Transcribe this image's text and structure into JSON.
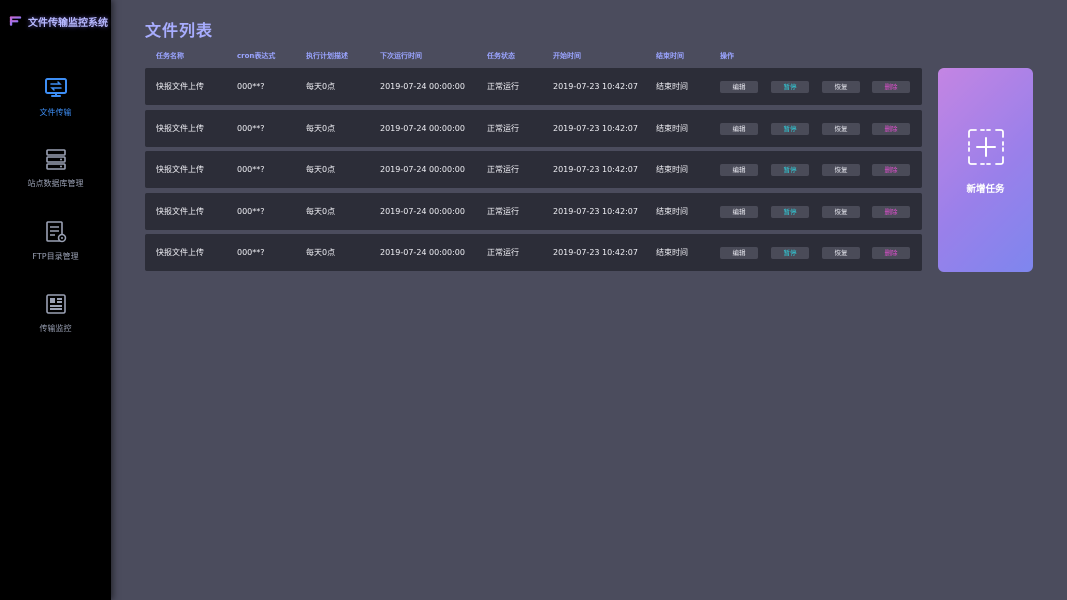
{
  "app": {
    "title": "文件传输监控系统"
  },
  "sidebar": {
    "items": [
      {
        "label": "文件传输",
        "icon": "monitor-transfer-icon",
        "active": true
      },
      {
        "label": "站点数据库管理",
        "icon": "database-icon",
        "active": false
      },
      {
        "label": "FTP目录管理",
        "icon": "ftp-directory-icon",
        "active": false
      },
      {
        "label": "传输监控",
        "icon": "dashboard-icon",
        "active": false
      }
    ]
  },
  "main": {
    "title": "文件列表",
    "columns": [
      "任务名称",
      "cron表达式",
      "执行计划描述",
      "下次运行时间",
      "任务状态",
      "开始时间",
      "结束时间",
      "操作"
    ],
    "actions": {
      "edit": "编辑",
      "pause": "暂停",
      "resume": "恢复",
      "delete": "删除"
    },
    "rows": [
      {
        "name": "快报文件上传",
        "cron": "000**?",
        "desc": "每天0点",
        "next": "2019-07-24  00:00:00",
        "status": "正常运行",
        "start": "2019-07-23  10:42:07",
        "end": "结束时间"
      },
      {
        "name": "快报文件上传",
        "cron": "000**?",
        "desc": "每天0点",
        "next": "2019-07-24  00:00:00",
        "status": "正常运行",
        "start": "2019-07-23  10:42:07",
        "end": "结束时间"
      },
      {
        "name": "快报文件上传",
        "cron": "000**?",
        "desc": "每天0点",
        "next": "2019-07-24  00:00:00",
        "status": "正常运行",
        "start": "2019-07-23  10:42:07",
        "end": "结束时间"
      },
      {
        "name": "快报文件上传",
        "cron": "000**?",
        "desc": "每天0点",
        "next": "2019-07-24  00:00:00",
        "status": "正常运行",
        "start": "2019-07-23  10:42:07",
        "end": "结束时间"
      },
      {
        "name": "快报文件上传",
        "cron": "000**?",
        "desc": "每天0点",
        "next": "2019-07-24  00:00:00",
        "status": "正常运行",
        "start": "2019-07-23  10:42:07",
        "end": "结束时间"
      }
    ],
    "new_task_label": "新增任务"
  },
  "colors": {
    "background": "#4b4c5d",
    "sidebar": "#000000",
    "row": "#2c2d38",
    "accent_blue": "#3d8ef5",
    "header_text": "#9aa4ff",
    "pause_text": "#2fd3e0",
    "delete_text": "#e24fd0"
  }
}
